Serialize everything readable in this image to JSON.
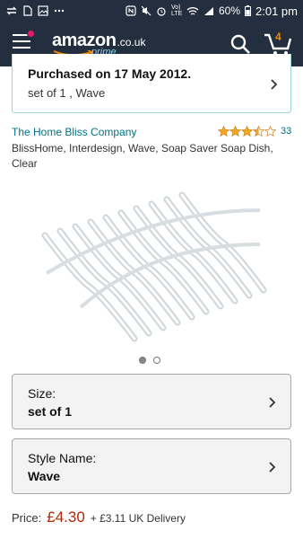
{
  "status_bar": {
    "battery": "60%",
    "time": "2:01 pm",
    "network": "Vo) LTE",
    "left_icons": [
      "swap-icon",
      "sim-card-icon",
      "image-icon",
      "more-dots-icon"
    ],
    "right_icons": [
      "nfc-icon",
      "mute-icon",
      "alarm-icon",
      "wifi-icon",
      "signal-icon",
      "battery-icon"
    ]
  },
  "header": {
    "logo_text": "amazon",
    "logo_tld": ".co.uk",
    "logo_prime": "prime",
    "cart_count": "4",
    "accent_color": "#f08804",
    "bg_color": "#232f3e"
  },
  "purchase": {
    "title": "Purchased on 17 May 2012.",
    "subtitle": "set of 1 , Wave"
  },
  "product": {
    "brand": "The Home Bliss Company",
    "rating": 3.5,
    "review_count": "33",
    "title": "BlissHome, Interdesign, Wave, Soap Saver Soap Dish, Clear",
    "image_count": 2,
    "active_image": 1
  },
  "options": {
    "size": {
      "label": "Size:",
      "value": "set of 1"
    },
    "style": {
      "label": "Style Name:",
      "value": "Wave"
    }
  },
  "pricing": {
    "label": "Price:",
    "price": "£4.30",
    "delivery": "+ £3.11 UK Delivery"
  }
}
